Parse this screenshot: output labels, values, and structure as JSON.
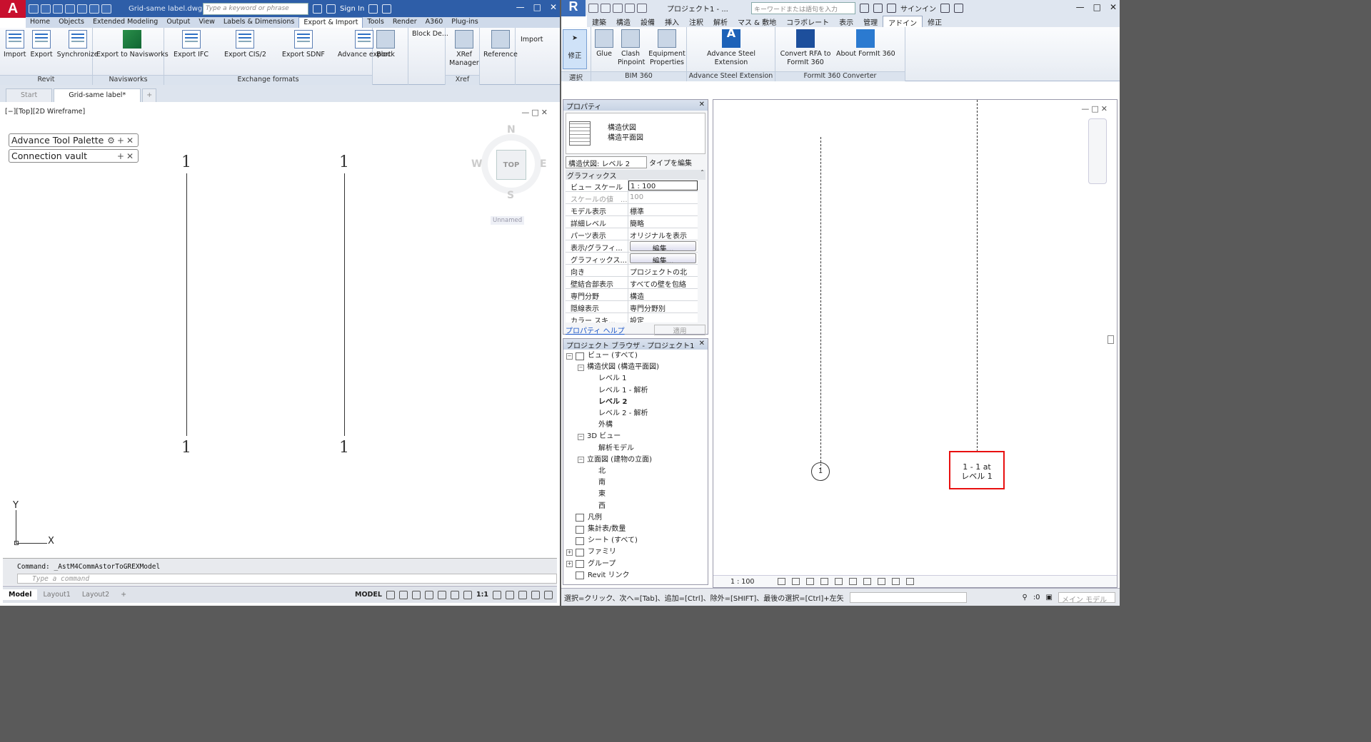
{
  "acad": {
    "app_letter": "A",
    "doc_title": "Grid-same label.dwg",
    "search_placeholder": "Type a keyword or phrase",
    "sign_in": "Sign In",
    "tabs": [
      "Home",
      "Objects",
      "Extended Modeling",
      "Output",
      "View",
      "Labels & Dimensions",
      "Export & Import",
      "Tools",
      "Render",
      "A360",
      "Plug-ins"
    ],
    "active_tab": "Export & Import",
    "panels": {
      "revit": {
        "title": "Revit",
        "buttons": [
          "Import",
          "Export",
          "Synchronize"
        ]
      },
      "navisworks": {
        "title": "Navisworks",
        "buttons": [
          "Export to Navisworks"
        ]
      },
      "exchange": {
        "title": "Exchange formats",
        "buttons": [
          "Export IFC",
          "Export CIS/2",
          "Export SDNF",
          "Advance export"
        ]
      },
      "block": {
        "buttons": [
          "Block"
        ]
      },
      "blockde": {
        "label": "Block De..."
      },
      "xref": {
        "title": "Xref",
        "buttons": [
          "XRef Manager"
        ]
      },
      "reference": {
        "buttons": [
          "Reference"
        ]
      },
      "import": {
        "buttons": [
          "Import"
        ]
      }
    },
    "doc_tabs": [
      "Start",
      "Grid-same label*"
    ],
    "viewport_label": "[−][Top][2D Wireframe]",
    "palettes": [
      "Advance Tool Palette",
      "Connection vault"
    ],
    "grid_labels": [
      "1",
      "1",
      "1",
      "1"
    ],
    "viewcube": {
      "face": "TOP",
      "n": "N",
      "s": "S",
      "e": "E",
      "w": "W",
      "named": "Unnamed"
    },
    "ucs": {
      "x": "X",
      "y": "Y"
    },
    "command_history": "Command: _AstM4CommAstorToGREXModel",
    "command_placeholder": "Type a command",
    "layout_tabs": [
      "Model",
      "Layout1",
      "Layout2"
    ],
    "status_model": "MODEL",
    "status_scale": "1:1"
  },
  "revit": {
    "app_letter": "R",
    "doc_title": "プロジェクト1 - ...",
    "search_placeholder": "キーワードまたは語句を入力",
    "sign_in": "サインイン",
    "tabs": [
      "建築",
      "構造",
      "設備",
      "挿入",
      "注釈",
      "解析",
      "マス & 敷地",
      "コラボレート",
      "表示",
      "管理",
      "アドイン",
      "修正"
    ],
    "active_tab": "アドイン",
    "ribbon": {
      "select": {
        "button": "修正",
        "title": "選択"
      },
      "bim360": {
        "title": "BIM 360",
        "buttons": [
          "Glue",
          "Clash Pinpoint",
          "Equipment Properties"
        ]
      },
      "steel": {
        "title": "Advance Steel Extension",
        "buttons": [
          "Advance Steel Extension"
        ]
      },
      "formit": {
        "title": "FormIt 360 Converter",
        "buttons": [
          "Convert RFA to FormIt 360",
          "About FormIt 360"
        ]
      }
    },
    "properties": {
      "title": "プロパティ",
      "type_line1": "構造伏図",
      "type_line2": "構造平面図",
      "instance": "構造伏図: レベル 2",
      "edit_type": "タイプを編集",
      "group": "グラフィックス",
      "rows": [
        {
          "k": "ビュー スケール",
          "v": "1 : 100",
          "style": "box"
        },
        {
          "k": "スケールの値　...",
          "v": "100",
          "style": "dim"
        },
        {
          "k": "モデル表示",
          "v": "標準",
          "style": ""
        },
        {
          "k": "詳細レベル",
          "v": "簡略",
          "style": ""
        },
        {
          "k": "パーツ表示",
          "v": "オリジナルを表示",
          "style": ""
        },
        {
          "k": "表示/グラフィ...",
          "v": "編集...",
          "style": "btn"
        },
        {
          "k": "グラフィックス...",
          "v": "編集...",
          "style": "btn"
        },
        {
          "k": "向き",
          "v": "プロジェクトの北",
          "style": ""
        },
        {
          "k": "壁結合部表示",
          "v": "すべての壁を包絡",
          "style": ""
        },
        {
          "k": "専門分野",
          "v": "構造",
          "style": ""
        },
        {
          "k": "隠線表示",
          "v": "専門分野別",
          "style": ""
        },
        {
          "k": "カラー スキ...",
          "v": "設定",
          "style": ""
        }
      ],
      "help": "プロパティ ヘルプ",
      "apply": "適用"
    },
    "browser": {
      "title": "プロジェクト ブラウザ - プロジェクト1",
      "items": [
        {
          "label": "ビュー (すべて)",
          "depth": 0,
          "exp": "−",
          "icon": true
        },
        {
          "label": "構造伏図 (構造平面図)",
          "depth": 1,
          "exp": "−",
          "icon": false
        },
        {
          "label": "レベル 1",
          "depth": 2,
          "exp": "",
          "icon": false
        },
        {
          "label": "レベル 1 - 解析",
          "depth": 2,
          "exp": "",
          "icon": false
        },
        {
          "label": "レベル 2",
          "depth": 2,
          "exp": "",
          "icon": false,
          "bold": true
        },
        {
          "label": "レベル 2 - 解析",
          "depth": 2,
          "exp": "",
          "icon": false
        },
        {
          "label": "外構",
          "depth": 2,
          "exp": "",
          "icon": false
        },
        {
          "label": "3D ビュー",
          "depth": 1,
          "exp": "−",
          "icon": false
        },
        {
          "label": "解析モデル",
          "depth": 2,
          "exp": "",
          "icon": false
        },
        {
          "label": "立面図 (建物の立面)",
          "depth": 1,
          "exp": "−",
          "icon": false
        },
        {
          "label": "北",
          "depth": 2,
          "exp": "",
          "icon": false
        },
        {
          "label": "南",
          "depth": 2,
          "exp": "",
          "icon": false
        },
        {
          "label": "東",
          "depth": 2,
          "exp": "",
          "icon": false
        },
        {
          "label": "西",
          "depth": 2,
          "exp": "",
          "icon": false
        },
        {
          "label": "凡例",
          "depth": 0,
          "exp": "",
          "icon": true
        },
        {
          "label": "集計表/数量",
          "depth": 0,
          "exp": "",
          "icon": true
        },
        {
          "label": "シート (すべて)",
          "depth": 0,
          "exp": "",
          "icon": true
        },
        {
          "label": "ファミリ",
          "depth": 0,
          "exp": "+",
          "icon": true
        },
        {
          "label": "グループ",
          "depth": 0,
          "exp": "+",
          "icon": true
        },
        {
          "label": "Revit リンク",
          "depth": 0,
          "exp": "",
          "icon": true
        }
      ]
    },
    "view": {
      "bubble": "1",
      "tag_line1": "1 - 1 at",
      "tag_line2": "レベル 1",
      "scale": "1 : 100"
    },
    "status_text": "選択=クリック、次へ=[Tab]、追加=[Ctrl]、除外=[SHIFT]、最後の選択=[Ctrl]+左矢",
    "status_zero": ":0",
    "status_model": "メイン モデル"
  },
  "colors": {
    "accent": "#2e5ea8",
    "highlight": "#e81010"
  }
}
